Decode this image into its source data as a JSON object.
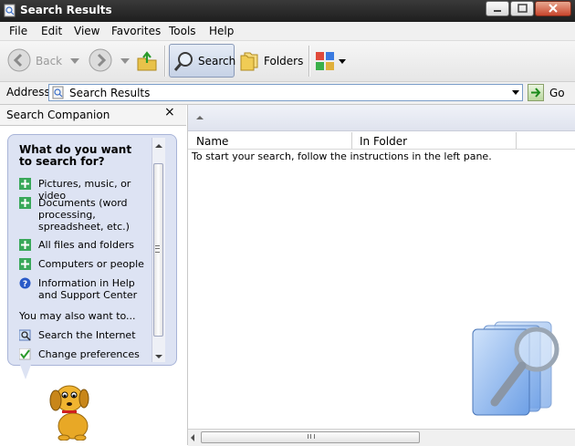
{
  "window": {
    "title": "Search Results",
    "accent": "#2a2a2a"
  },
  "menu": [
    "File",
    "Edit",
    "View",
    "Favorites",
    "Tools",
    "Help"
  ],
  "toolbar": {
    "back": "Back",
    "search": "Search",
    "folders": "Folders"
  },
  "address": {
    "label": "Address",
    "value": "Search Results",
    "go": "Go"
  },
  "companion": {
    "title": "Search Companion",
    "close": "×",
    "question": "What do you want to search for?",
    "options": [
      {
        "label": "Pictures, music, or video",
        "icon": "arrow-cross-icon"
      },
      {
        "label": "Documents (word processing, spreadsheet, etc.)",
        "icon": "arrow-cross-icon"
      },
      {
        "label": "All files and folders",
        "icon": "arrow-cross-icon"
      },
      {
        "label": "Computers or people",
        "icon": "arrow-cross-icon"
      },
      {
        "label": "Information in Help and Support Center",
        "icon": "help-icon"
      }
    ],
    "also": "You may also want to...",
    "extra": [
      {
        "label": "Search the Internet",
        "icon": "search-internet-icon"
      },
      {
        "label": "Change preferences",
        "icon": "checkmark-icon"
      }
    ]
  },
  "results": {
    "columns": [
      "Name",
      "In Folder"
    ],
    "hint": "To start your search, follow the instructions in the left pane."
  }
}
